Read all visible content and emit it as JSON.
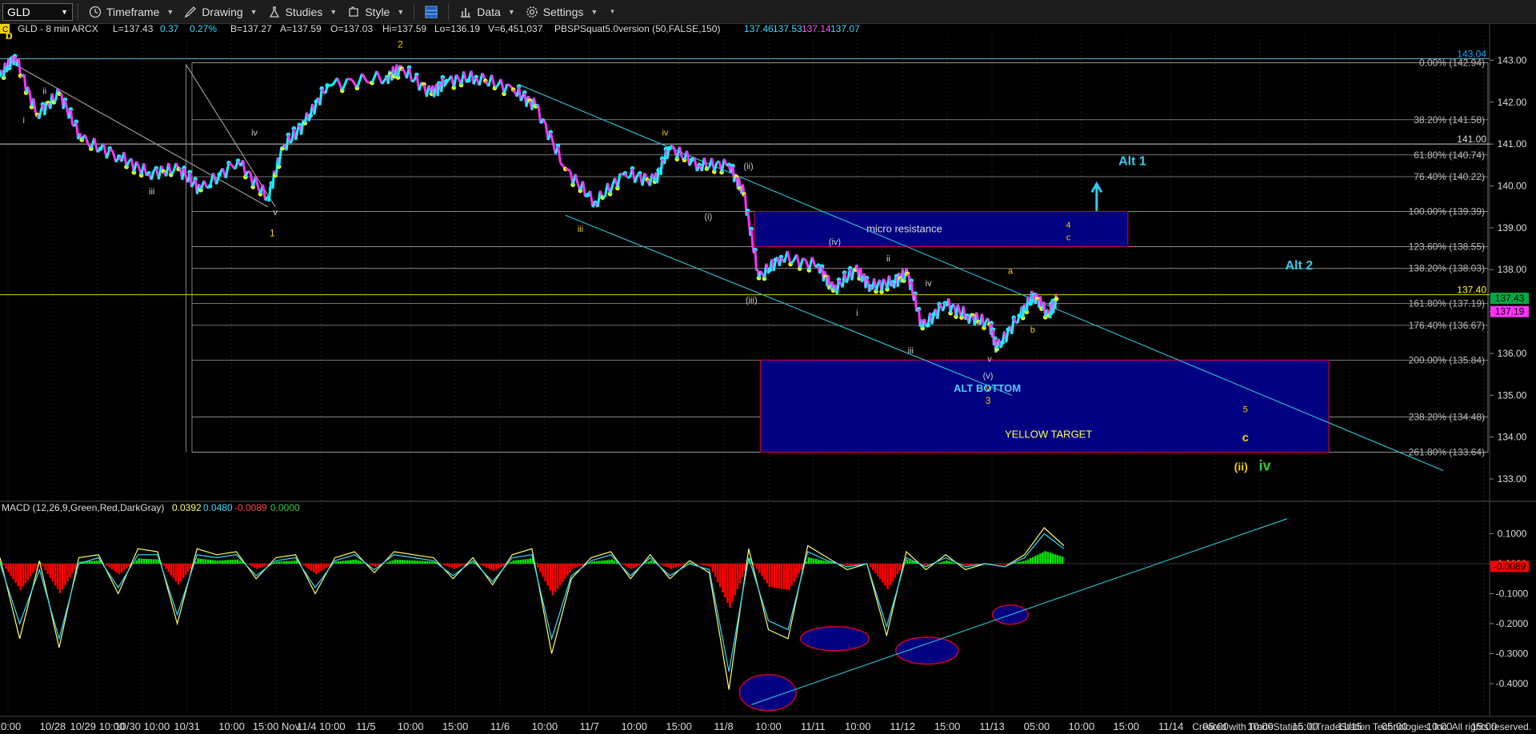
{
  "toolbar": {
    "symbol": "GLD",
    "timeframe_label": "Timeframe",
    "drawing_label": "Drawing",
    "studies_label": "Studies",
    "style_label": "Style",
    "data_label": "Data",
    "settings_label": "Settings"
  },
  "header": {
    "corner": "C",
    "symbol_line": "GLD - 8 min  ARCX",
    "last": "L=137.43",
    "change": "0.37",
    "pct": "0.27%",
    "bid": "B=137.27",
    "ask": "A=137.59",
    "open": "O=137.03",
    "high": "Hi=137.59",
    "low": "Lo=136.19",
    "volume": "V=6,451,037",
    "study": "PBSPSquat5.0version (50,FALSE,150)",
    "study_values": [
      "137.46",
      "137.53",
      "137.14",
      "137.07"
    ]
  },
  "macd_header": {
    "label": "MACD (12,26,9,Green,Red,DarkGray)",
    "values": [
      "0.0392",
      "0.0480",
      "-0.0089",
      "0.0000"
    ]
  },
  "footer": "Created with TradeStation. ©TradeStation Technologies, Inc. All rights reserved.",
  "colors": {
    "price_up": "#00ffff",
    "price_down": "#ff33ff",
    "price_dot": "#ffff00",
    "fib_line": "#9a9a9a",
    "trend_line": "#2ab7c9",
    "box_fill": "#000080",
    "macd_pos": "#00e600",
    "macd_neg": "#ff0000",
    "label_yellow": "#f0d000",
    "label_cyan": "#33ccee"
  },
  "chart_data": [
    {
      "type": "line",
      "name": "price",
      "y_axis_ticks": [
        143.0,
        142.0,
        141.0,
        140.0,
        139.0,
        138.0,
        137.0,
        136.0,
        135.0,
        134.0,
        133.0
      ],
      "ylim": [
        132.6,
        143.6
      ],
      "x_axis_ticks": [
        "10:00",
        "10/28",
        "10/29 10:00",
        "10/30 10:00",
        "10/31",
        "10:00",
        "15:00 Nov",
        "11/4 10:00",
        "11/5",
        "10:00",
        "15:00",
        "11/6",
        "10:00",
        "11/7",
        "10:00",
        "15:00",
        "11/8",
        "10:00",
        "11/11",
        "10:00",
        "11/12",
        "15:00",
        "11/13",
        "05:00",
        "10:00",
        "15:00",
        "11/14",
        "05:00",
        "10:00",
        "15:00",
        "11/15",
        "05:00",
        "10:00",
        "15:00"
      ],
      "path": [
        [
          0,
          142.6
        ],
        [
          0.01,
          143.1
        ],
        [
          0.025,
          141.7
        ],
        [
          0.04,
          142.2
        ],
        [
          0.055,
          141.1
        ],
        [
          0.08,
          140.7
        ],
        [
          0.1,
          140.3
        ],
        [
          0.12,
          140.4
        ],
        [
          0.135,
          139.9
        ],
        [
          0.16,
          140.6
        ],
        [
          0.18,
          139.7
        ],
        [
          0.19,
          140.9
        ],
        [
          0.205,
          141.5
        ],
        [
          0.22,
          142.4
        ],
        [
          0.26,
          142.6
        ],
        [
          0.27,
          142.8
        ],
        [
          0.29,
          142.2
        ],
        [
          0.3,
          142.5
        ],
        [
          0.32,
          142.6
        ],
        [
          0.345,
          142.3
        ],
        [
          0.36,
          141.9
        ],
        [
          0.38,
          140.4
        ],
        [
          0.4,
          139.6
        ],
        [
          0.42,
          140.3
        ],
        [
          0.44,
          140.1
        ],
        [
          0.45,
          140.9
        ],
        [
          0.47,
          140.5
        ],
        [
          0.49,
          140.5
        ],
        [
          0.5,
          139.8
        ],
        [
          0.51,
          137.8
        ],
        [
          0.525,
          138.3
        ],
        [
          0.55,
          138.1
        ],
        [
          0.56,
          137.5
        ],
        [
          0.575,
          138.0
        ],
        [
          0.585,
          137.6
        ],
        [
          0.6,
          137.7
        ],
        [
          0.61,
          137.9
        ],
        [
          0.62,
          136.6
        ],
        [
          0.635,
          137.2
        ],
        [
          0.65,
          136.9
        ],
        [
          0.665,
          136.7
        ],
        [
          0.67,
          136.1
        ],
        [
          0.685,
          136.9
        ],
        [
          0.695,
          137.4
        ],
        [
          0.705,
          136.9
        ],
        [
          0.71,
          137.3
        ]
      ],
      "fib_levels": [
        {
          "label": "0.00% (142.94)",
          "value": 142.94
        },
        {
          "label": "38.20% (141.58)",
          "value": 141.58
        },
        {
          "label": "61.80% (140.74)",
          "value": 140.74
        },
        {
          "label": "76.40% (140.22)",
          "value": 140.22
        },
        {
          "label": "100.00% (139.39)",
          "value": 139.39
        },
        {
          "label": "123.60% (138.55)",
          "value": 138.55
        },
        {
          "label": "138.20% (138.03)",
          "value": 138.03
        },
        {
          "label": "161.80% (137.19)",
          "value": 137.19
        },
        {
          "label": "176.40% (136.67)",
          "value": 136.67
        },
        {
          "label": "200.00% (135.84)",
          "value": 135.84
        },
        {
          "label": "238.20% (134.48)",
          "value": 134.48
        },
        {
          "label": "261.80% (133.64)",
          "value": 133.64
        }
      ],
      "price_flags": [
        {
          "label": "143.04",
          "value": 143.04,
          "color": "#00aaff"
        },
        {
          "label": "141.00",
          "value": 141.0,
          "color": "#dddddd"
        },
        {
          "label": "137.40",
          "value": 137.4,
          "color": "#ffff00"
        },
        {
          "label": "137.43",
          "value": 137.43,
          "color": "#00aa44"
        },
        {
          "label": "137.19",
          "value": 137.19,
          "color": "#ff33ff"
        }
      ],
      "boxes": [
        {
          "label": "micro resistance",
          "x0": 0.507,
          "x1": 0.758,
          "y0": 139.39,
          "y1": 138.55
        },
        {
          "label": "ALT BOTTOM",
          "x0": 0.511,
          "x1": 0.893,
          "y0": 135.84,
          "y1": 134.48
        },
        {
          "label": "YELLOW TARGET",
          "x0": 0.511,
          "x1": 0.893,
          "y0": 134.48,
          "y1": 133.64
        }
      ],
      "wave_labels": [
        {
          "text": "b",
          "x": 0.006,
          "y": 143.5,
          "color": "#f0d000",
          "size": 15
        },
        {
          "text": "i",
          "x": 0.016,
          "y": 141.5,
          "color": "#ccc",
          "size": 11
        },
        {
          "text": "ii",
          "x": 0.03,
          "y": 142.2,
          "color": "#ccc",
          "size": 11
        },
        {
          "text": "iii",
          "x": 0.102,
          "y": 139.8,
          "color": "#ccc",
          "size": 11
        },
        {
          "text": "iv",
          "x": 0.171,
          "y": 141.2,
          "color": "#ccc",
          "size": 11
        },
        {
          "text": "v",
          "x": 0.185,
          "y": 139.3,
          "color": "#ccc",
          "size": 11
        },
        {
          "text": "1",
          "x": 0.183,
          "y": 138.8,
          "color": "#f0d000",
          "size": 12
        },
        {
          "text": "2",
          "x": 0.269,
          "y": 143.3,
          "color": "#f0d000",
          "size": 12
        },
        {
          "text": "iv",
          "x": 0.447,
          "y": 141.2,
          "color": "#f0d000",
          "size": 11
        },
        {
          "text": "iii",
          "x": 0.39,
          "y": 138.9,
          "color": "#f0d000",
          "size": 11
        },
        {
          "text": "(ii)",
          "x": 0.503,
          "y": 140.4,
          "color": "#ccc",
          "size": 11
        },
        {
          "text": "(i)",
          "x": 0.476,
          "y": 139.2,
          "color": "#ccc",
          "size": 11
        },
        {
          "text": "(iv)",
          "x": 0.561,
          "y": 138.6,
          "color": "#ccc",
          "size": 11
        },
        {
          "text": "(iii)",
          "x": 0.505,
          "y": 137.2,
          "color": "#ccc",
          "size": 11
        },
        {
          "text": "ii",
          "x": 0.597,
          "y": 138.2,
          "color": "#ccc",
          "size": 11
        },
        {
          "text": "i",
          "x": 0.576,
          "y": 136.9,
          "color": "#ccc",
          "size": 11
        },
        {
          "text": "iv",
          "x": 0.624,
          "y": 137.6,
          "color": "#ccc",
          "size": 11
        },
        {
          "text": "iii",
          "x": 0.612,
          "y": 136.0,
          "color": "#ccc",
          "size": 11
        },
        {
          "text": "v",
          "x": 0.665,
          "y": 135.8,
          "color": "#ccc",
          "size": 11
        },
        {
          "text": "(v)",
          "x": 0.664,
          "y": 135.4,
          "color": "#ccc",
          "size": 11
        },
        {
          "text": "v",
          "x": 0.664,
          "y": 135.1,
          "color": "#f0d000",
          "size": 11
        },
        {
          "text": "3",
          "x": 0.664,
          "y": 134.8,
          "color": "#f0d000",
          "size": 12
        },
        {
          "text": "a",
          "x": 0.679,
          "y": 137.9,
          "color": "#f0d000",
          "size": 11
        },
        {
          "text": "b",
          "x": 0.694,
          "y": 136.5,
          "color": "#f0d000",
          "size": 11
        },
        {
          "text": "4",
          "x": 0.718,
          "y": 139.0,
          "color": "#f0d000",
          "size": 11
        },
        {
          "text": "c",
          "x": 0.718,
          "y": 138.7,
          "color": "#f0d000",
          "size": 11
        },
        {
          "text": "5",
          "x": 0.837,
          "y": 134.6,
          "color": "#f0d000",
          "size": 11
        },
        {
          "text": "c",
          "x": 0.837,
          "y": 133.9,
          "color": "#f0d000",
          "size": 15
        },
        {
          "text": "(ii)",
          "x": 0.834,
          "y": 133.2,
          "color": "#f0d000",
          "size": 14
        },
        {
          "text": "iv",
          "x": 0.85,
          "y": 133.2,
          "color": "#33cc33",
          "size": 18
        },
        {
          "text": "Alt 1",
          "x": 0.761,
          "y": 140.5,
          "color": "#33ccee",
          "size": 16
        },
        {
          "text": "Alt 2",
          "x": 0.873,
          "y": 138.0,
          "color": "#33ccee",
          "size": 16
        }
      ]
    },
    {
      "type": "area",
      "name": "MACD (12,26,9,Green,Red,DarkGray)",
      "y_axis_ticks": [
        0.1,
        0.0,
        -0.1,
        -0.2,
        -0.3,
        -0.4
      ],
      "ylim": [
        -0.48,
        0.16
      ],
      "macd": [
        0.02,
        -0.25,
        0.01,
        -0.28,
        0.02,
        0.03,
        -0.1,
        0.05,
        0.04,
        -0.2,
        0.05,
        0.03,
        0.04,
        -0.05,
        0.02,
        0.03,
        -0.1,
        0.02,
        0.04,
        -0.03,
        0.04,
        0.03,
        0.02,
        -0.05,
        0.02,
        -0.07,
        0.03,
        0.05,
        -0.3,
        -0.05,
        0.02,
        0.04,
        -0.05,
        0.03,
        -0.05,
        0.01,
        -0.03,
        -0.42,
        0.05,
        -0.22,
        -0.25,
        0.06,
        0.02,
        -0.02,
        0.0,
        -0.24,
        0.04,
        -0.02,
        0.03,
        -0.02,
        0.0,
        -0.01,
        0.03,
        0.12,
        0.06
      ],
      "signal": [
        0.0,
        -0.2,
        -0.02,
        -0.25,
        0.0,
        0.02,
        -0.08,
        0.03,
        0.03,
        -0.17,
        0.03,
        0.02,
        0.03,
        -0.04,
        0.01,
        0.02,
        -0.08,
        0.01,
        0.03,
        -0.02,
        0.03,
        0.02,
        0.01,
        -0.04,
        0.01,
        -0.06,
        0.02,
        0.03,
        -0.25,
        -0.04,
        0.01,
        0.03,
        -0.04,
        0.02,
        -0.04,
        0.0,
        -0.02,
        -0.36,
        0.02,
        -0.19,
        -0.22,
        0.04,
        0.01,
        -0.01,
        0.0,
        -0.21,
        0.02,
        -0.01,
        0.02,
        -0.01,
        0.0,
        -0.01,
        0.02,
        0.1,
        0.05
      ],
      "ellipses": [
        {
          "cx": 0.516,
          "cy": -0.43,
          "rx": 0.019,
          "ry": 0.06
        },
        {
          "cx": 0.561,
          "cy": -0.25,
          "rx": 0.023,
          "ry": 0.04
        },
        {
          "cx": 0.623,
          "cy": -0.29,
          "rx": 0.021,
          "ry": 0.045
        },
        {
          "cx": 0.679,
          "cy": -0.17,
          "rx": 0.012,
          "ry": 0.032
        }
      ]
    }
  ]
}
